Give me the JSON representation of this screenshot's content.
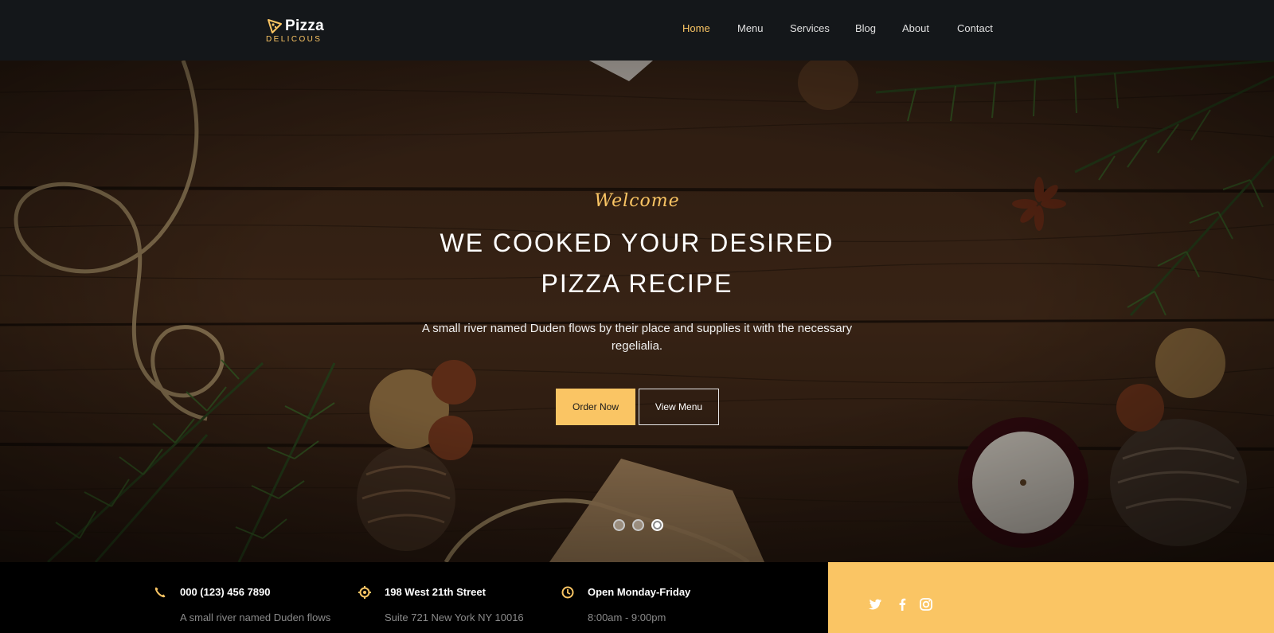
{
  "brand": {
    "title": "Pizza",
    "subtitle": "DELICOUS",
    "accent_color": "#fac564",
    "icon": "pizza-slice-icon"
  },
  "nav": {
    "items": [
      {
        "label": "Home",
        "active": true
      },
      {
        "label": "Menu",
        "active": false
      },
      {
        "label": "Services",
        "active": false
      },
      {
        "label": "Blog",
        "active": false
      },
      {
        "label": "About",
        "active": false
      },
      {
        "label": "Contact",
        "active": false
      }
    ]
  },
  "hero": {
    "welcome": "Welcome",
    "title_line1": "WE COOKED YOUR DESIRED",
    "title_line2": "PIZZA RECIPE",
    "text": "A small river named Duden flows by their place and supplies it with the necessary regelialia.",
    "order_button": "Order Now",
    "view_button": "View Menu",
    "slides_total": 3,
    "active_slide": 3
  },
  "info": {
    "phone": {
      "icon": "phone-icon",
      "title": "000 (123) 456 7890",
      "sub": "A small river named Duden flows"
    },
    "address": {
      "icon": "location-icon",
      "title": "198 West 21th Street",
      "sub": "Suite 721 New York NY 10016"
    },
    "hours": {
      "icon": "clock-icon",
      "title": "Open Monday-Friday",
      "sub": "8:00am - 9:00pm"
    }
  },
  "social": {
    "items": [
      {
        "icon": "twitter-icon"
      },
      {
        "icon": "facebook-icon"
      },
      {
        "icon": "instagram-icon"
      }
    ]
  }
}
